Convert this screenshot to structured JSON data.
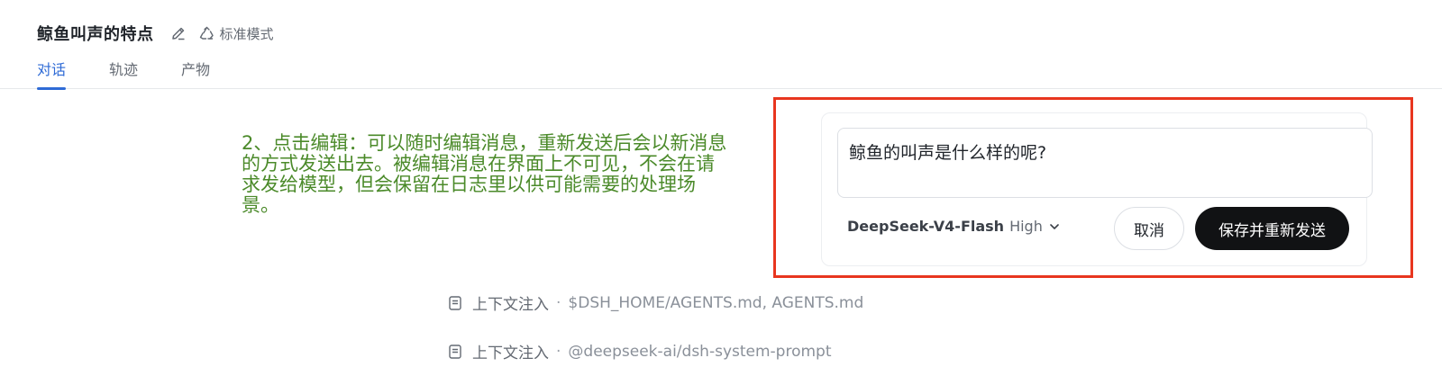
{
  "header": {
    "title": "鲸鱼叫声的特点",
    "mode_label": "标准模式"
  },
  "tabs": [
    {
      "label": "对话",
      "active": true
    },
    {
      "label": "轨迹",
      "active": false
    },
    {
      "label": "产物",
      "active": false
    }
  ],
  "annotation": {
    "text": "2、点击编辑：可以随时编辑消息，重新发送后会以新消息的方式发送出去。被编辑消息在界面上不可见，不会在请求发给模型，但会保留在日志里以供可能需要的处理场景。"
  },
  "edit_card": {
    "input_value": "鲸鱼的叫声是什么样的呢?",
    "model_name": "DeepSeek-V4-Flash",
    "model_level": "High",
    "cancel_label": "取消",
    "save_label": "保存并重新发送"
  },
  "context_rows": [
    {
      "label": "上下文注入",
      "value": "$DSH_HOME/AGENTS.md, AGENTS.md"
    },
    {
      "label": "上下文注入",
      "value": "@deepseek-ai/dsh-system-prompt"
    }
  ],
  "colors": {
    "accent": "#2f6bd6",
    "annotation": "#4b8a2a",
    "highlight": "#e8361f",
    "primary_button": "#111214"
  }
}
